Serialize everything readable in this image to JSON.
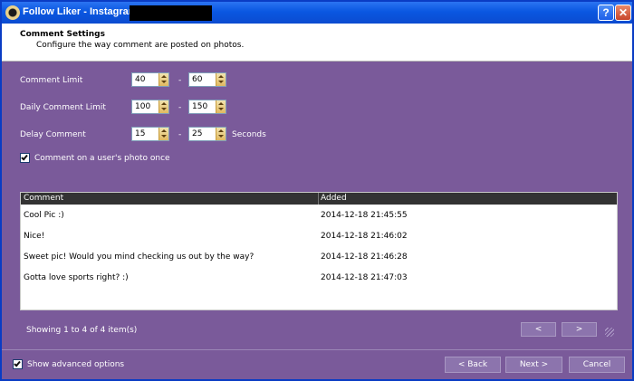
{
  "window": {
    "title": "Follow Liker - Instagram"
  },
  "header": {
    "title": "Comment Settings",
    "subtitle": "Configure the way comment are posted on photos."
  },
  "settings": {
    "comment_limit": {
      "label": "Comment Limit",
      "min": "40",
      "max": "60"
    },
    "daily_comment_limit": {
      "label": "Daily Comment Limit",
      "min": "100",
      "max": "150"
    },
    "delay_comment": {
      "label": "Delay Comment",
      "min": "15",
      "max": "25",
      "unit": "Seconds"
    },
    "range_separator": "-",
    "once_checkbox": {
      "label": "Comment on a user's photo once",
      "checked": true
    }
  },
  "grid": {
    "columns": [
      "Comment",
      "Added"
    ],
    "rows": [
      {
        "comment": "Cool Pic :)",
        "added": "2014-12-18 21:45:55"
      },
      {
        "comment": "Nice!",
        "added": "2014-12-18 21:46:02"
      },
      {
        "comment": "Sweet pic! Would you mind checking us out by the way?",
        "added": "2014-12-18 21:46:28"
      },
      {
        "comment": "Gotta love sports right? :)",
        "added": "2014-12-18 21:47:03"
      }
    ]
  },
  "pager": {
    "status": "Showing 1 to 4 of 4 item(s)",
    "prev": "<",
    "next": ">"
  },
  "footer": {
    "advanced_label": "Show advanced options",
    "advanced_checked": true,
    "back": "< Back",
    "next": "Next >",
    "cancel": "Cancel"
  },
  "colors": {
    "panel": "#7a5a9a",
    "titlebar": "#0a57e1"
  }
}
